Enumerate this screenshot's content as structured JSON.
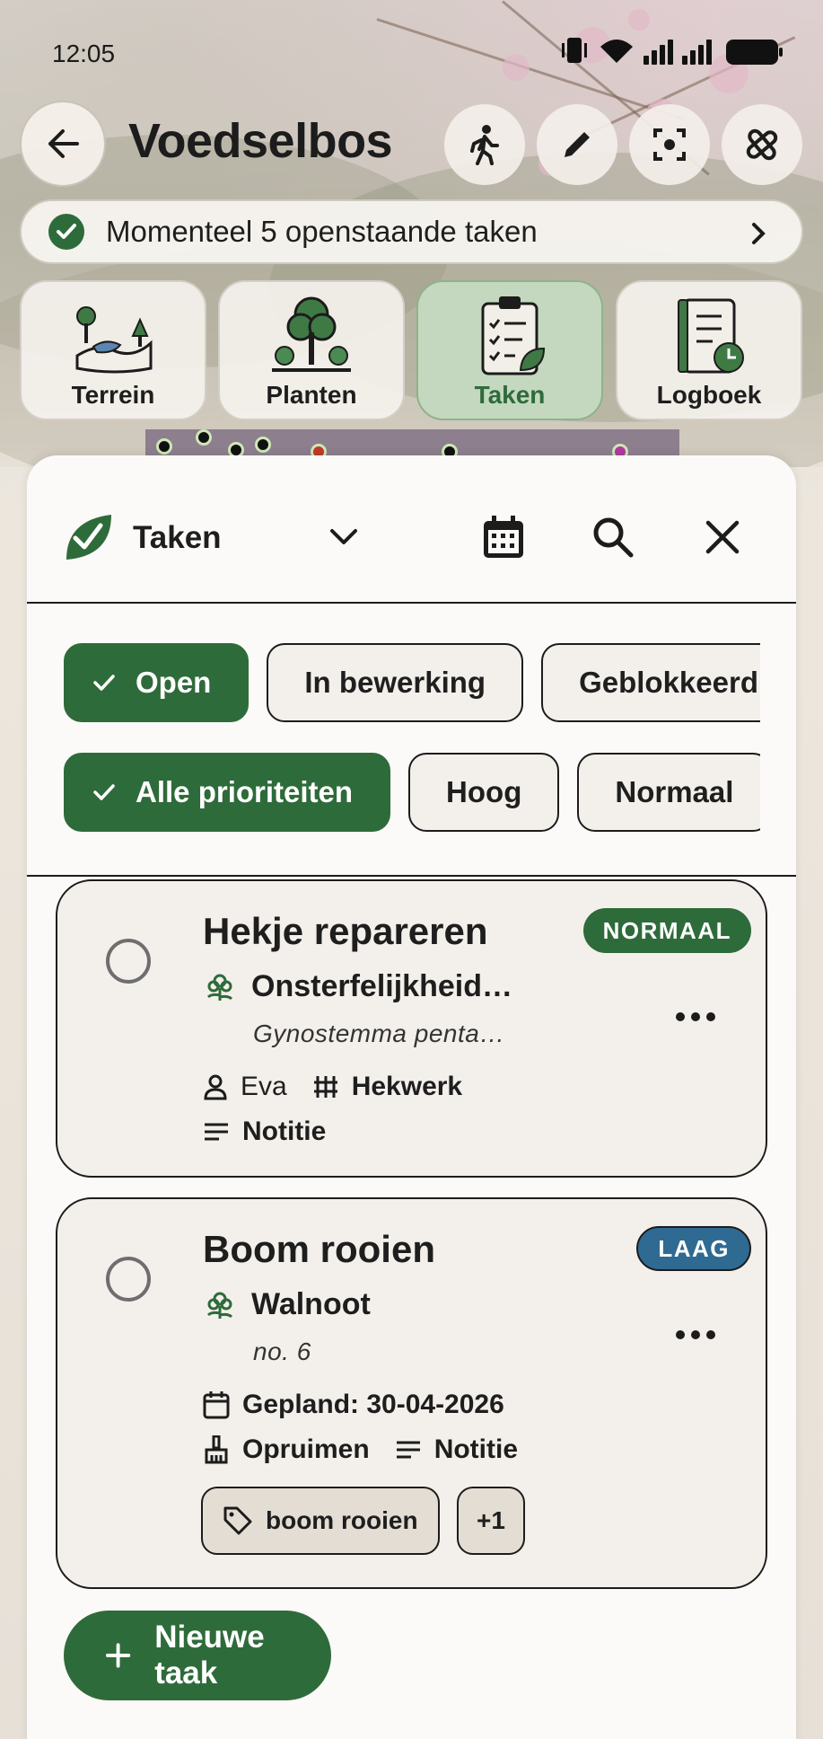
{
  "status_bar": {
    "time": "12:05"
  },
  "header": {
    "title": "Voedselbos",
    "back_icon": "arrow-left-icon",
    "actions": [
      "walk-icon",
      "edit-pencil-icon",
      "focus-scan-icon",
      "bandage-icon"
    ]
  },
  "banner": {
    "text": "Momenteel 5 openstaande taken"
  },
  "categories": [
    {
      "label": "Terrein",
      "active": false
    },
    {
      "label": "Planten",
      "active": false
    },
    {
      "label": "Taken",
      "active": true
    },
    {
      "label": "Logboek",
      "active": false
    }
  ],
  "panel": {
    "title": "Taken",
    "status_filters": [
      "Open",
      "In bewerking",
      "Geblokkeerd"
    ],
    "priority_filters": [
      "Alle prioriteiten",
      "Hoog",
      "Normaal"
    ]
  },
  "tasks": [
    {
      "title": "Hekje repareren",
      "plant": "Onsterfelijkheid…",
      "sub": "Gynostemma penta…",
      "priority": "NORMAAL",
      "assignee": "Eva",
      "category": "Hekwerk",
      "note": "Notitie"
    },
    {
      "title": "Boom rooien",
      "plant": "Walnoot",
      "sub": "no. 6",
      "priority": "LAAG",
      "planned": "Gepland: 30-04-2026",
      "category": "Opruimen",
      "note": "Notitie",
      "tag": "boom rooien",
      "extra_tags": "+1"
    }
  ],
  "fab": {
    "label": "Nieuwe taak"
  },
  "colors": {
    "primary": "#2e6b3a",
    "low": "#2f6a92",
    "active_tile": "#c3d8bf"
  }
}
